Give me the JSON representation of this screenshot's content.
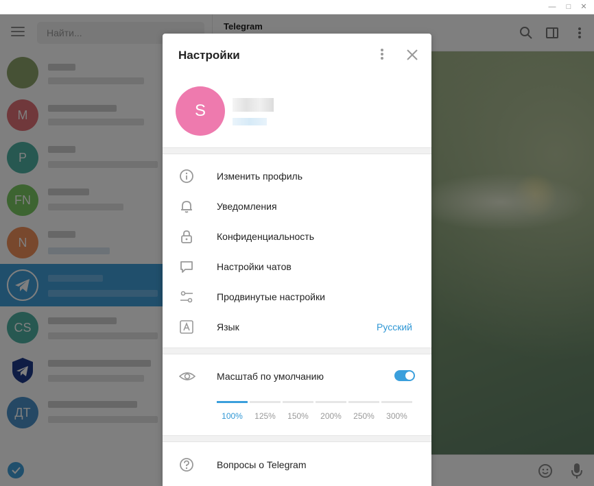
{
  "left": {
    "search_placeholder": "Найти...",
    "chats": [
      {
        "avatar_text": "",
        "avatar_color": "#8da36a"
      },
      {
        "avatar_text": "M",
        "avatar_color": "#e17076"
      },
      {
        "avatar_text": "P",
        "avatar_color": "#4fb1a3"
      },
      {
        "avatar_text": "FN",
        "avatar_color": "#7bc862"
      },
      {
        "avatar_text": "N",
        "avatar_color": "#f0915a"
      },
      {
        "avatar_text": "",
        "avatar_color": "#419fd9"
      },
      {
        "avatar_text": "CS",
        "avatar_color": "#4fb1a3"
      },
      {
        "avatar_text": "",
        "avatar_color": "#1e3a8a"
      },
      {
        "avatar_text": "ДТ",
        "avatar_color": "#4a90c8"
      }
    ]
  },
  "right": {
    "chat_title": "Telegram"
  },
  "settings": {
    "title": "Настройки",
    "profile_initial": "S",
    "menu": {
      "edit_profile": "Изменить профиль",
      "notifications": "Уведомления",
      "privacy": "Конфиденциальность",
      "chat_settings": "Настройки чатов",
      "advanced": "Продвинутые настройки",
      "language": "Язык",
      "language_value": "Русский",
      "default_scale": "Масштаб по умолчанию",
      "faq": "Вопросы о Telegram"
    },
    "scale": {
      "default_scale_enabled": true,
      "options": [
        "100%",
        "125%",
        "150%",
        "200%",
        "250%",
        "300%"
      ],
      "selected": "100%"
    }
  },
  "colors": {
    "accent": "#3a9fdc",
    "link": "#2f97d5",
    "profile_avatar": "#ee7aae"
  }
}
